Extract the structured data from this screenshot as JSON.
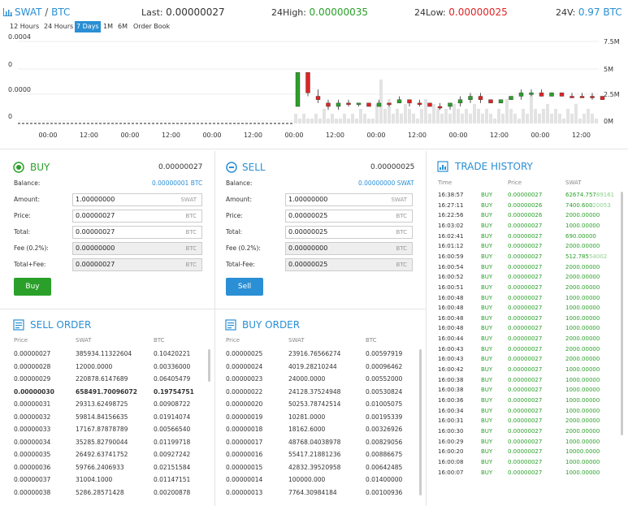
{
  "ticker": {
    "base": "SWAT",
    "sep": "/",
    "quote": "BTC",
    "last_label": "Last:",
    "last": "0.00000027",
    "high_label": "24High:",
    "high": "0.00000035",
    "low_label": "24Low:",
    "low": "0.00000025",
    "vol_label": "24V:",
    "vol": "0.97 BTC"
  },
  "timeframes": [
    {
      "label": "12 Hours",
      "active": false
    },
    {
      "label": "24 Hours",
      "active": false
    },
    {
      "label": "7 Days",
      "active": true
    },
    {
      "label": "1M",
      "active": false
    },
    {
      "label": "6M",
      "active": false
    },
    {
      "label": "Order Book",
      "active": false
    }
  ],
  "chart_data": {
    "type": "candlestick",
    "left_axis": [
      "0.0004",
      "0",
      "0.0000",
      "0"
    ],
    "right_axis": [
      "7.5M",
      "5M",
      "2.5M",
      "0M"
    ],
    "x_ticks": [
      "00:00",
      "12:00",
      "00:00",
      "12:00",
      "00:00",
      "12:00",
      "00:00",
      "12:00",
      "00:00",
      "12:00",
      "00:00",
      "12:00",
      "00:00",
      "12:00"
    ],
    "candles": [
      {
        "o": 2.5e-07,
        "c": 3.5e-07,
        "h": 3.5e-07,
        "l": 2.5e-07,
        "up": true
      },
      {
        "o": 3.5e-07,
        "c": 2.9e-07,
        "h": 3.5e-07,
        "l": 2.8e-07,
        "up": false
      },
      {
        "o": 2.8e-07,
        "c": 2.7e-07,
        "h": 3e-07,
        "l": 2.6e-07,
        "up": false
      },
      {
        "o": 2.6e-07,
        "c": 2.5e-07,
        "h": 2.7e-07,
        "l": 2.4e-07,
        "up": false
      },
      {
        "o": 2.5e-07,
        "c": 2.6e-07,
        "h": 2.7e-07,
        "l": 2.4e-07,
        "up": true
      },
      {
        "o": 2.6e-07,
        "c": 2.6e-07,
        "h": 2.7e-07,
        "l": 2.5e-07,
        "up": false
      },
      {
        "o": 2.6e-07,
        "c": 2.6e-07,
        "h": 2.6e-07,
        "l": 2.5e-07,
        "up": true
      },
      {
        "o": 2.6e-07,
        "c": 2.5e-07,
        "h": 2.6e-07,
        "l": 2.5e-07,
        "up": false
      },
      {
        "o": 2.5e-07,
        "c": 2.6e-07,
        "h": 2.7e-07,
        "l": 2.5e-07,
        "up": true
      },
      {
        "o": 2.6e-07,
        "c": 2.6e-07,
        "h": 2.6e-07,
        "l": 2.5e-07,
        "up": false
      },
      {
        "o": 2.6e-07,
        "c": 2.7e-07,
        "h": 2.8e-07,
        "l": 2.6e-07,
        "up": true
      },
      {
        "o": 2.7e-07,
        "c": 2.6e-07,
        "h": 2.7e-07,
        "l": 2.5e-07,
        "up": false
      },
      {
        "o": 2.6e-07,
        "c": 2.6e-07,
        "h": 2.7e-07,
        "l": 2.5e-07,
        "up": false
      },
      {
        "o": 2.6e-07,
        "c": 2.5e-07,
        "h": 2.6e-07,
        "l": 2.5e-07,
        "up": false
      },
      {
        "o": 2.5e-07,
        "c": 2.5e-07,
        "h": 2.6e-07,
        "l": 2.4e-07,
        "up": false
      },
      {
        "o": 2.5e-07,
        "c": 2.6e-07,
        "h": 2.6e-07,
        "l": 2.4e-07,
        "up": true
      },
      {
        "o": 2.6e-07,
        "c": 2.7e-07,
        "h": 2.8e-07,
        "l": 2.5e-07,
        "up": true
      },
      {
        "o": 2.7e-07,
        "c": 2.8e-07,
        "h": 2.9e-07,
        "l": 2.6e-07,
        "up": true
      },
      {
        "o": 2.8e-07,
        "c": 2.7e-07,
        "h": 2.9e-07,
        "l": 2.6e-07,
        "up": false
      },
      {
        "o": 2.7e-07,
        "c": 2.6e-07,
        "h": 2.7e-07,
        "l": 2.6e-07,
        "up": false
      },
      {
        "o": 2.6e-07,
        "c": 2.7e-07,
        "h": 2.7e-07,
        "l": 2.6e-07,
        "up": true
      },
      {
        "o": 2.7e-07,
        "c": 2.8e-07,
        "h": 2.8e-07,
        "l": 2.7e-07,
        "up": true
      },
      {
        "o": 2.8e-07,
        "c": 2.9e-07,
        "h": 3e-07,
        "l": 2.7e-07,
        "up": true
      },
      {
        "o": 2.9e-07,
        "c": 2.9e-07,
        "h": 3e-07,
        "l": 2.8e-07,
        "up": true
      },
      {
        "o": 2.9e-07,
        "c": 2.8e-07,
        "h": 3e-07,
        "l": 2.8e-07,
        "up": false
      },
      {
        "o": 2.8e-07,
        "c": 2.9e-07,
        "h": 2.9e-07,
        "l": 2.8e-07,
        "up": true
      },
      {
        "o": 2.9e-07,
        "c": 2.8e-07,
        "h": 2.9e-07,
        "l": 2.8e-07,
        "up": false
      },
      {
        "o": 2.8e-07,
        "c": 2.8e-07,
        "h": 2.9e-07,
        "l": 2.8e-07,
        "up": false
      },
      {
        "o": 2.8e-07,
        "c": 2.8e-07,
        "h": 2.9e-07,
        "l": 2.8e-07,
        "up": false
      },
      {
        "o": 2.8e-07,
        "c": 2.8e-07,
        "h": 2.9e-07,
        "l": 2.7e-07,
        "up": false
      },
      {
        "o": 2.8e-07,
        "c": 2.7e-07,
        "h": 2.8e-07,
        "l": 2.7e-07,
        "up": false
      }
    ],
    "volumes": [
      0.2,
      0.1,
      0.2,
      0.1,
      0.1,
      0.2,
      0.1,
      0.3,
      0.1,
      0.2,
      0.1,
      0.1,
      0.2,
      0.1,
      0.2,
      0.1,
      0.3,
      0.2,
      0.1,
      0.1,
      0.4,
      0.9,
      0.3,
      0.5,
      0.2,
      0.3,
      0.2,
      0.4,
      0.3,
      0.2,
      0.1,
      0.3,
      0.5,
      0.2,
      0.4,
      0.3,
      0.2,
      0.3,
      0.2,
      0.4,
      0.3,
      0.2,
      0.3,
      0.2,
      0.4,
      0.3,
      0.2,
      0.3,
      0.2,
      0.1,
      0.3,
      0.2,
      0.5,
      0.3,
      0.2,
      0.1,
      0.3,
      0.2,
      0.6,
      0.3,
      0.2,
      0.3,
      0.4,
      0.2,
      0.3,
      0.2,
      0.1,
      0.3,
      0.2,
      0.4,
      0.1,
      0.2,
      0.3,
      0.2,
      0.1
    ]
  },
  "buy": {
    "title": "BUY",
    "price_head": "0.00000027",
    "balance_label": "Balance:",
    "balance": "0.00000001 BTC",
    "amount_label": "Amount:",
    "amount": "1.00000000",
    "amount_unit": "SWAT",
    "price_label": "Price:",
    "price": "0.00000027",
    "price_unit": "BTC",
    "total_label": "Total:",
    "total": "0.00000027",
    "total_unit": "BTC",
    "fee_label": "Fee (0.2%):",
    "fee": "0.00000000",
    "fee_unit": "BTC",
    "tf_label": "Total+Fee:",
    "tf": "0.00000027",
    "tf_unit": "BTC",
    "button": "Buy",
    "color": "#2aa02a"
  },
  "sell": {
    "title": "SELL",
    "price_head": "0.00000025",
    "balance_label": "Balance:",
    "balance": "0.00000000 SWAT",
    "amount_label": "Amount:",
    "amount": "1.00000000",
    "amount_unit": "SWAT",
    "price_label": "Price:",
    "price": "0.00000025",
    "price_unit": "BTC",
    "total_label": "Total:",
    "total": "0.00000025",
    "total_unit": "BTC",
    "fee_label": "Fee (0.2%):",
    "fee": "0.00000000",
    "fee_unit": "BTC",
    "tf_label": "Total-Fee:",
    "tf": "0.00000025",
    "tf_unit": "BTC",
    "button": "Sell",
    "color": "#2a8fd4"
  },
  "sell_order": {
    "title": "SELL ORDER",
    "headers": [
      "Price",
      "SWAT",
      "BTC"
    ],
    "rows": [
      [
        "0.00000027",
        "385934.11322604",
        "0.10420221"
      ],
      [
        "0.00000028",
        "12000.0000",
        "0.00336000"
      ],
      [
        "0.00000029",
        "220878.6147689",
        "0.06405479"
      ],
      [
        "0.00000030",
        "658491.70096072",
        "0.19754751"
      ],
      [
        "0.00000031",
        "29313.62498725",
        "0.00908722"
      ],
      [
        "0.00000032",
        "59814.84156635",
        "0.01914074"
      ],
      [
        "0.00000033",
        "17167.87878789",
        "0.00566540"
      ],
      [
        "0.00000034",
        "35285.82790044",
        "0.01199718"
      ],
      [
        "0.00000035",
        "26492.63741752",
        "0.00927242"
      ],
      [
        "0.00000036",
        "59766.2406933",
        "0.02151584"
      ],
      [
        "0.00000037",
        "31004.1000",
        "0.01147151"
      ],
      [
        "0.00000038",
        "5286.28571428",
        "0.00200878"
      ]
    ],
    "bold_row": 3
  },
  "buy_order": {
    "title": "BUY ORDER",
    "headers": [
      "Price",
      "SWAT",
      "BTC"
    ],
    "rows": [
      [
        "0.00000025",
        "23916.76566274",
        "0.00597919"
      ],
      [
        "0.00000024",
        "4019.28210244",
        "0.00096462"
      ],
      [
        "0.00000023",
        "24000.0000",
        "0.00552000"
      ],
      [
        "0.00000022",
        "24128.37524948",
        "0.00530824"
      ],
      [
        "0.00000020",
        "50253.78742514",
        "0.01005075"
      ],
      [
        "0.00000019",
        "10281.0000",
        "0.00195339"
      ],
      [
        "0.00000018",
        "18162.6000",
        "0.00326926"
      ],
      [
        "0.00000017",
        "48768.04038978",
        "0.00829056"
      ],
      [
        "0.00000016",
        "55417.21881236",
        "0.00886675"
      ],
      [
        "0.00000015",
        "42832.39520958",
        "0.00642485"
      ],
      [
        "0.00000014",
        "100000.000",
        "0.01400000"
      ],
      [
        "0.00000013",
        "7764.30984184",
        "0.00100936"
      ]
    ]
  },
  "trade_history": {
    "title": "TRADE HISTORY",
    "headers": [
      "Time",
      "Price",
      "SWAT"
    ],
    "rows": [
      [
        "16:38:57",
        "BUY",
        "0.00000027",
        "62674.757",
        "89161"
      ],
      [
        "16:27:11",
        "BUY",
        "0.00000026",
        "7400.600",
        "20053"
      ],
      [
        "16:22:56",
        "BUY",
        "0.00000026",
        "2000.00000",
        ""
      ],
      [
        "16:03:02",
        "BUY",
        "0.00000027",
        "1000.00000",
        ""
      ],
      [
        "16:02:41",
        "BUY",
        "0.00000027",
        "690.00000",
        ""
      ],
      [
        "16:01:12",
        "BUY",
        "0.00000027",
        "2000.00000",
        ""
      ],
      [
        "16:00:59",
        "BUY",
        "0.00000027",
        "512.785",
        "54002"
      ],
      [
        "16:00:54",
        "BUY",
        "0.00000027",
        "2000.00000",
        ""
      ],
      [
        "16:00:52",
        "BUY",
        "0.00000027",
        "2000.00000",
        ""
      ],
      [
        "16:00:51",
        "BUY",
        "0.00000027",
        "2000.00000",
        ""
      ],
      [
        "16:00:48",
        "BUY",
        "0.00000027",
        "1000.00000",
        ""
      ],
      [
        "16:00:48",
        "BUY",
        "0.00000027",
        "1000.00000",
        ""
      ],
      [
        "16:00:48",
        "BUY",
        "0.00000027",
        "1000.00000",
        ""
      ],
      [
        "16:00:48",
        "BUY",
        "0.00000027",
        "1000.00000",
        ""
      ],
      [
        "16:00:44",
        "BUY",
        "0.00000027",
        "2000.00000",
        ""
      ],
      [
        "16:00:43",
        "BUY",
        "0.00000027",
        "2000.00000",
        ""
      ],
      [
        "16:00:43",
        "BUY",
        "0.00000027",
        "2000.00000",
        ""
      ],
      [
        "16:00:42",
        "BUY",
        "0.00000027",
        "1000.00000",
        ""
      ],
      [
        "16:00:38",
        "BUY",
        "0.00000027",
        "1000.00000",
        ""
      ],
      [
        "16:00:38",
        "BUY",
        "0.00000027",
        "1000.00000",
        ""
      ],
      [
        "16:00:36",
        "BUY",
        "0.00000027",
        "1000.00000",
        ""
      ],
      [
        "16:00:34",
        "BUY",
        "0.00000027",
        "1000.00000",
        ""
      ],
      [
        "16:00:31",
        "BUY",
        "0.00000027",
        "2000.00000",
        ""
      ],
      [
        "16:00:30",
        "BUY",
        "0.00000027",
        "2000.00000",
        ""
      ],
      [
        "16:00:29",
        "BUY",
        "0.00000027",
        "1000.00000",
        ""
      ],
      [
        "16:00:20",
        "BUY",
        "0.00000027",
        "10000.0000",
        ""
      ],
      [
        "16:00:08",
        "BUY",
        "0.00000027",
        "1000.00000",
        ""
      ],
      [
        "16:00:07",
        "BUY",
        "0.00000027",
        "1000.00000",
        ""
      ]
    ]
  }
}
